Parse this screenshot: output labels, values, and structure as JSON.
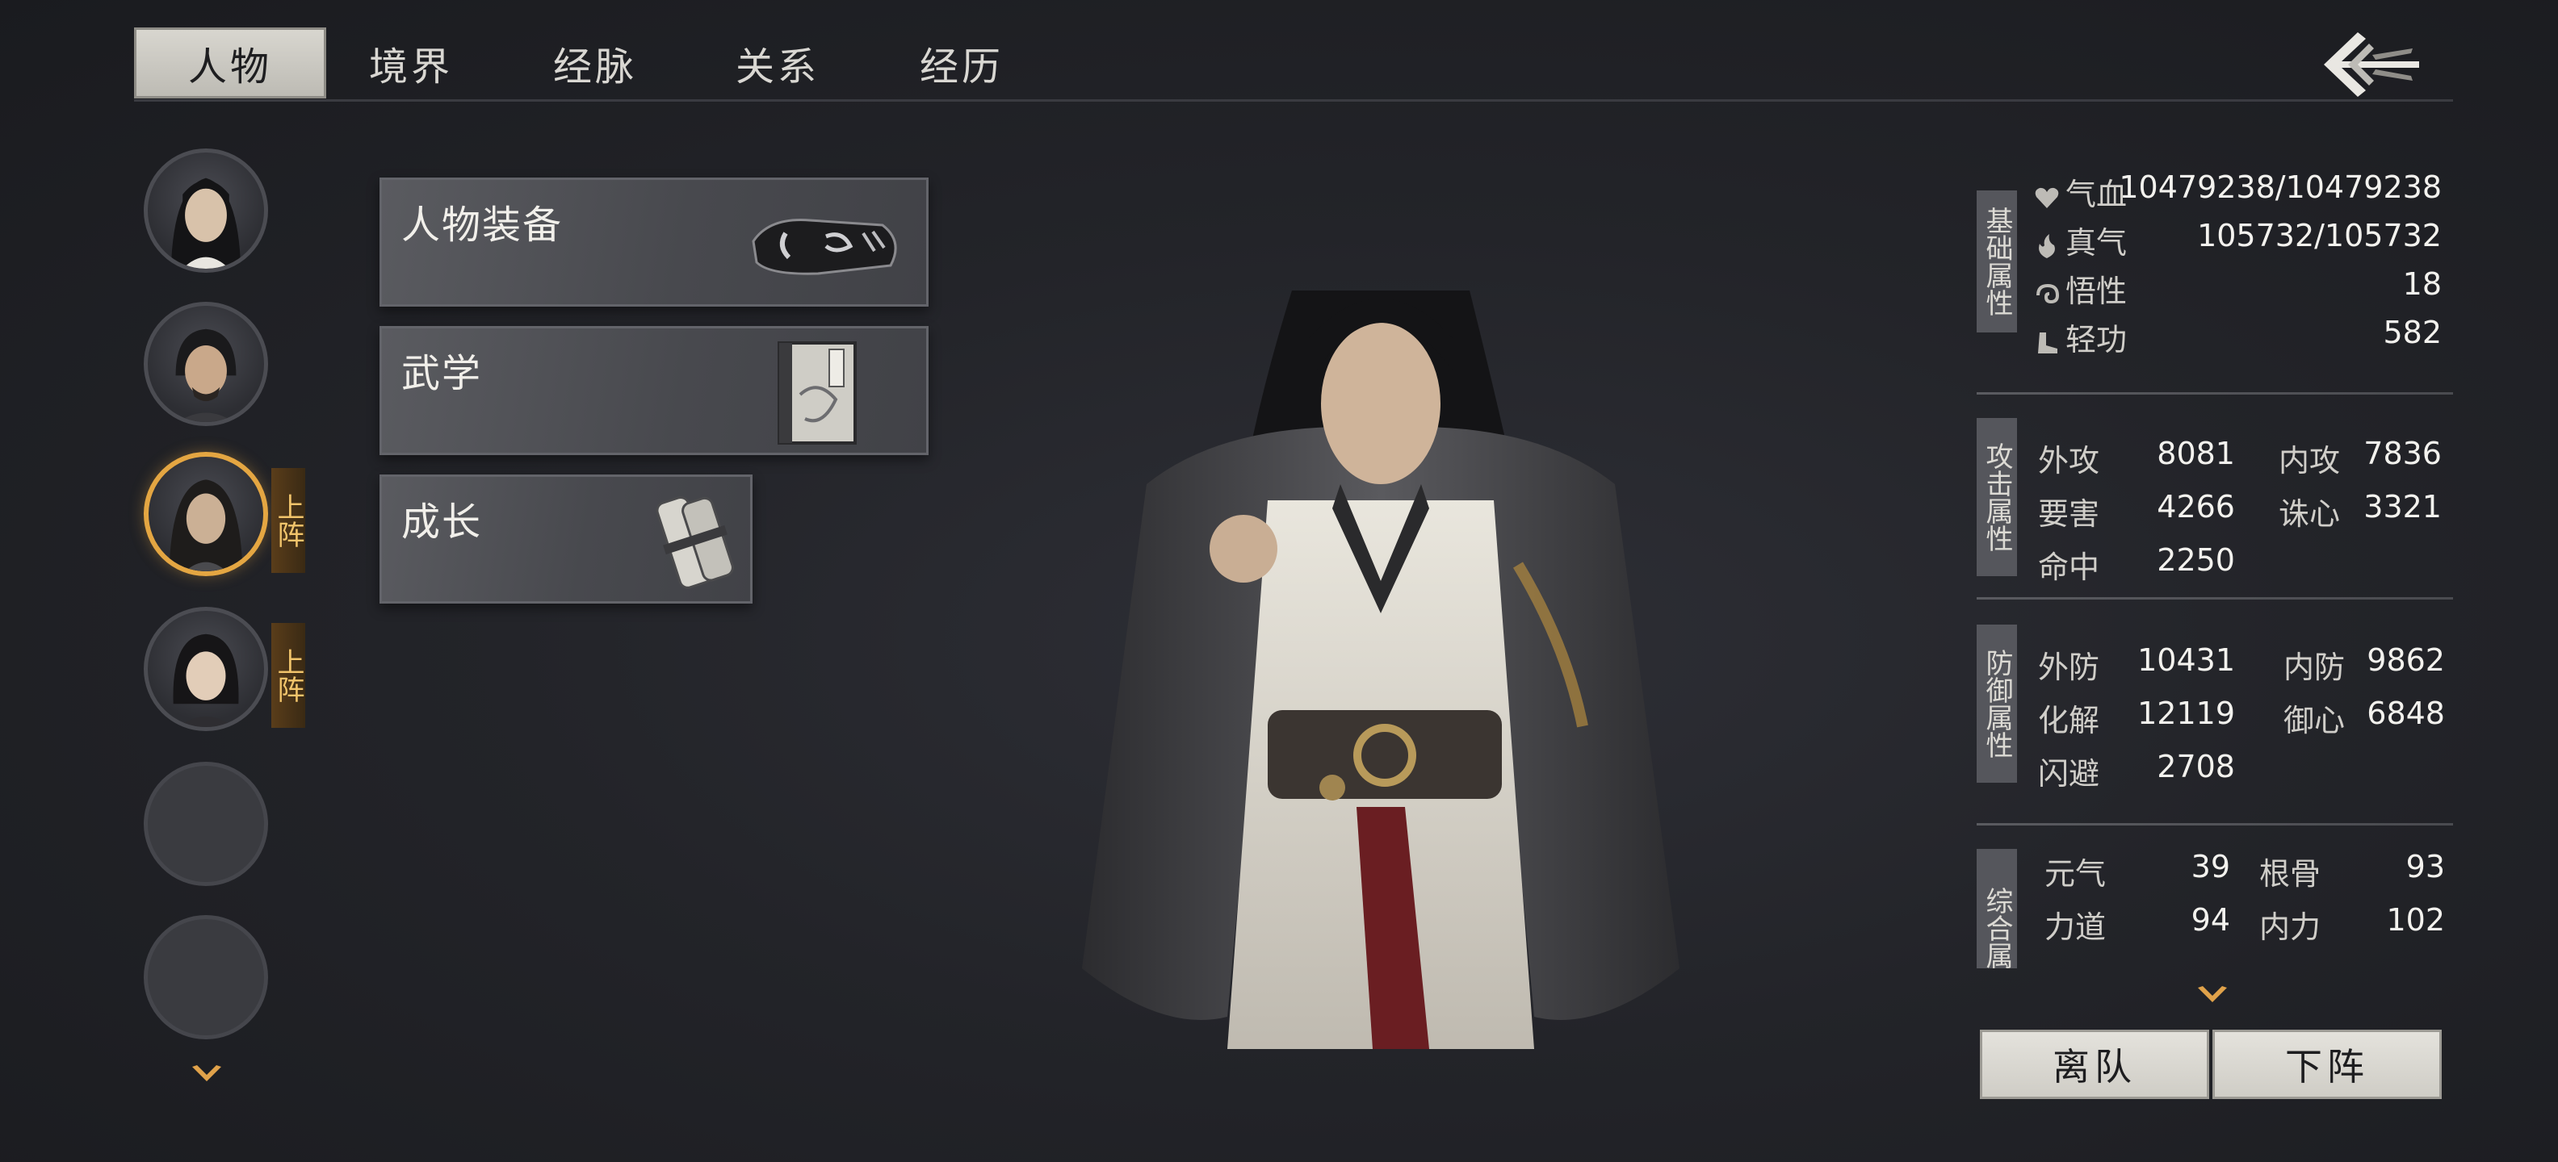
{
  "tabs": [
    "人物",
    "境界",
    "经脉",
    "关系",
    "经历"
  ],
  "roster": {
    "onfield_label": "上阵"
  },
  "menu": {
    "equipment": "人物装备",
    "martial_arts": "武学",
    "growth": "成长"
  },
  "sections": {
    "basic": "基础属性",
    "attack": "攻击属性",
    "defense": "防御属性",
    "general": "综合属"
  },
  "basic_stats": [
    {
      "label": "气血",
      "value": "10479238/10479238",
      "icon": "heart-icon"
    },
    {
      "label": "真气",
      "value": "105732/105732",
      "icon": "flame-icon"
    },
    {
      "label": "悟性",
      "value": "18",
      "icon": "swirl-icon"
    },
    {
      "label": "轻功",
      "value": "582",
      "icon": "boot-icon"
    }
  ],
  "attack_stats": [
    {
      "label": "外攻",
      "value": "8081"
    },
    {
      "label": "内攻",
      "value": "7836"
    },
    {
      "label": "要害",
      "value": "4266"
    },
    {
      "label": "诛心",
      "value": "3321"
    },
    {
      "label": "命中",
      "value": "2250"
    }
  ],
  "defense_stats": [
    {
      "label": "外防",
      "value": "10431"
    },
    {
      "label": "内防",
      "value": "9862"
    },
    {
      "label": "化解",
      "value": "12119"
    },
    {
      "label": "御心",
      "value": "6848"
    },
    {
      "label": "闪避",
      "value": "2708"
    }
  ],
  "general_stats": [
    {
      "label": "元气",
      "value": "39"
    },
    {
      "label": "根骨",
      "value": "93"
    },
    {
      "label": "力道",
      "value": "94"
    },
    {
      "label": "内力",
      "value": "102"
    }
  ],
  "actions": {
    "leave": "离队",
    "unassign": "下阵"
  },
  "colors": {
    "accent_gold": "#e4a642",
    "panel_dark": "#232429"
  }
}
